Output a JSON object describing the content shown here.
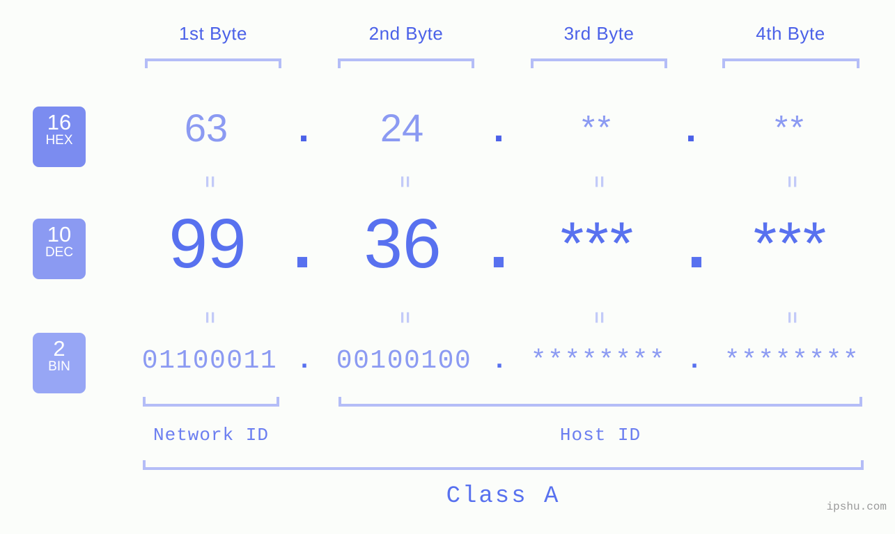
{
  "meta": {
    "watermark": "ipshu.com",
    "accent": "#4b61e8",
    "accent_light": "#8b9af2",
    "bracket_color": "#b4bdf7",
    "background": "#fbfdfa"
  },
  "byte_headers": [
    {
      "label": "1st Byte"
    },
    {
      "label": "2nd Byte"
    },
    {
      "label": "3rd Byte"
    },
    {
      "label": "4th Byte"
    }
  ],
  "bases": [
    {
      "num": "16",
      "name": "HEX",
      "color": "#7b8cf0"
    },
    {
      "num": "10",
      "name": "DEC",
      "color": "#8b9af2"
    },
    {
      "num": "2",
      "name": "BIN",
      "color": "#97a6f5"
    }
  ],
  "rows": {
    "hex": {
      "base_num": "16",
      "base_name": "HEX",
      "values": [
        "63",
        "24",
        "**",
        "**"
      ],
      "separator": "."
    },
    "dec": {
      "base_num": "10",
      "base_name": "DEC",
      "values": [
        "99",
        "36",
        "***",
        "***"
      ],
      "separator": "."
    },
    "bin": {
      "base_num": "2",
      "base_name": "BIN",
      "values": [
        "01100011",
        "00100100",
        "********",
        "********"
      ],
      "separator": "."
    }
  },
  "equals_glyph": "=",
  "segments": {
    "network_id": "Network ID",
    "host_id": "Host ID",
    "class": "Class A"
  }
}
